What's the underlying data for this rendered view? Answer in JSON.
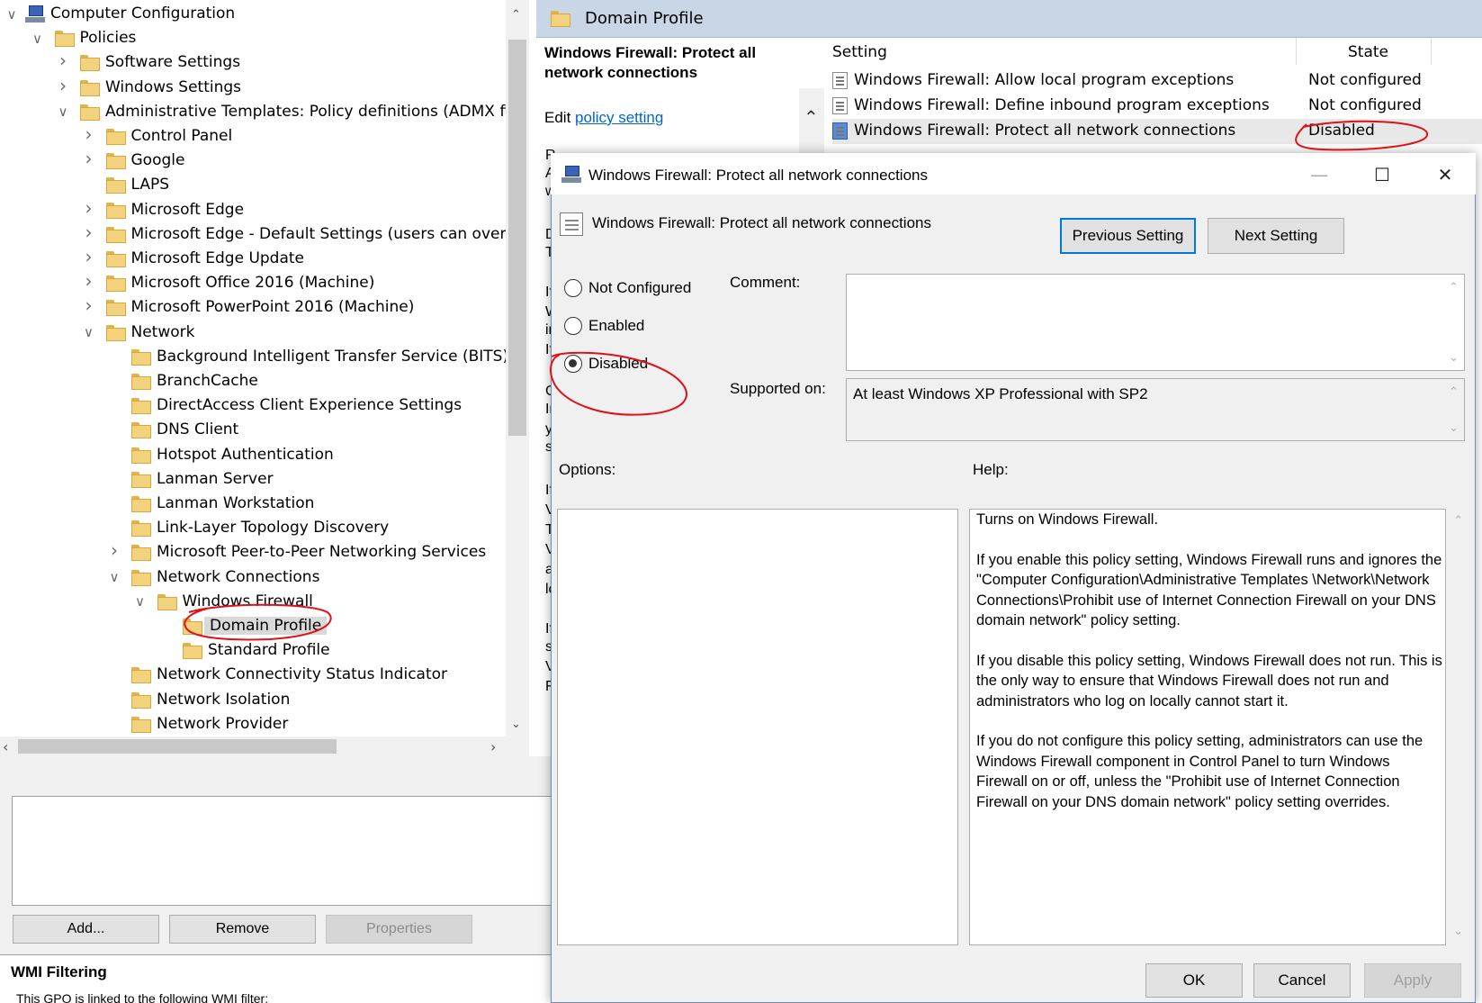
{
  "tree": {
    "root": "Computer Configuration",
    "items": [
      {
        "label": "Policies"
      },
      {
        "label": "Software Settings"
      },
      {
        "label": "Windows Settings"
      },
      {
        "label": "Administrative Templates: Policy definitions (ADMX files)"
      },
      {
        "label": "Control Panel"
      },
      {
        "label": "Google"
      },
      {
        "label": "LAPS"
      },
      {
        "label": "Microsoft Edge"
      },
      {
        "label": "Microsoft Edge - Default Settings (users can override)"
      },
      {
        "label": "Microsoft Edge Update"
      },
      {
        "label": "Microsoft Office 2016 (Machine)"
      },
      {
        "label": "Microsoft PowerPoint 2016 (Machine)"
      },
      {
        "label": "Network"
      },
      {
        "label": "Background Intelligent Transfer Service (BITS)"
      },
      {
        "label": "BranchCache"
      },
      {
        "label": "DirectAccess Client Experience Settings"
      },
      {
        "label": "DNS Client"
      },
      {
        "label": "Hotspot Authentication"
      },
      {
        "label": "Lanman Server"
      },
      {
        "label": "Lanman Workstation"
      },
      {
        "label": "Link-Layer Topology Discovery"
      },
      {
        "label": "Microsoft Peer-to-Peer Networking Services"
      },
      {
        "label": "Network Connections"
      },
      {
        "label": "Windows Firewall"
      },
      {
        "label": "Domain Profile"
      },
      {
        "label": "Standard Profile"
      },
      {
        "label": "Network Connectivity Status Indicator"
      },
      {
        "label": "Network Isolation"
      },
      {
        "label": "Network Provider"
      }
    ]
  },
  "lower": {
    "add": "Add...",
    "remove": "Remove",
    "properties": "Properties",
    "wmi_title": "WMI Filtering",
    "wmi_text": "This GPO is linked to the following WMI filter:"
  },
  "right": {
    "header_title": "Domain Profile",
    "ext_title": "Windows Firewall: Protect all network connections",
    "edit_prefix": "Edit",
    "edit_link": "policy setting",
    "col_setting": "Setting",
    "col_state": "State",
    "settings": [
      {
        "name": "Windows Firewall: Allow local program exceptions",
        "state": "Not configured"
      },
      {
        "name": "Windows Firewall: Define inbound program exceptions",
        "state": "Not configured"
      },
      {
        "name": "Windows Firewall: Protect all network connections",
        "state": "Disabled"
      }
    ],
    "peek_letters": [
      "R",
      "A",
      "w",
      "D",
      "T",
      "If",
      "W",
      "ir",
      "If",
      "C",
      "Ir",
      "y",
      "s",
      "If",
      "V",
      "T",
      "V",
      "a",
      "lc",
      "If",
      "s",
      "V",
      "F"
    ]
  },
  "dialog": {
    "title": "Windows Firewall: Protect all network connections",
    "policy_name": "Windows Firewall: Protect all network connections",
    "prev": "Previous Setting",
    "next": "Next Setting",
    "radio_not_configured": "Not Configured",
    "radio_enabled": "Enabled",
    "radio_disabled": "Disabled",
    "selected": "Disabled",
    "comment_label": "Comment:",
    "supported_label": "Supported on:",
    "supported_value": "At least Windows XP Professional with SP2",
    "options_label": "Options:",
    "help_label": "Help:",
    "help": [
      "Turns on Windows Firewall.",
      "If you enable this policy setting, Windows Firewall runs and ignores the \"Computer Configuration\\Administrative Templates \\Network\\Network Connections\\Prohibit use of Internet Connection Firewall on your DNS domain network\" policy setting.",
      "If you disable this policy setting, Windows Firewall does not run. This is the only way to ensure that Windows Firewall does not run and administrators who log on locally cannot start it.",
      "If you do not configure this policy setting, administrators can use the Windows Firewall component in Control Panel to turn Windows Firewall on or off, unless the \"Prohibit use of Internet Connection Firewall on your DNS domain network\" policy setting overrides."
    ],
    "ok": "OK",
    "cancel": "Cancel",
    "apply": "Apply"
  },
  "colors": {
    "annotation": "#e0101a",
    "header_bg": "#c9d6e6",
    "link": "#0066cc",
    "default_button_border": "#0078d7"
  }
}
